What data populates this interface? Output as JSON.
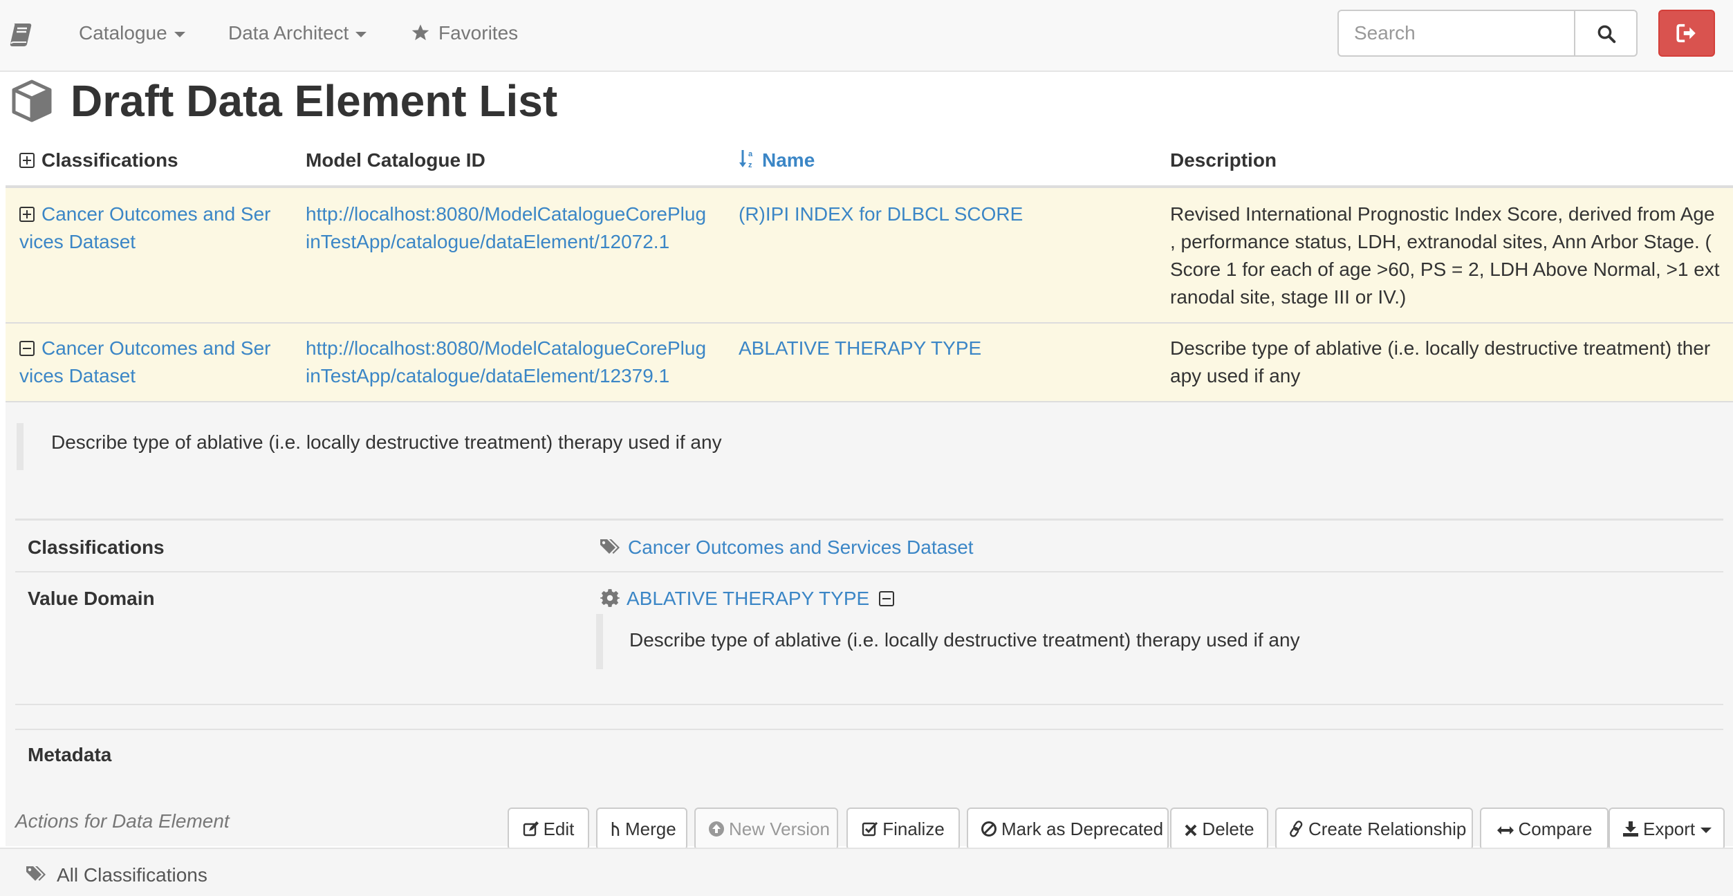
{
  "navbar": {
    "brand_icon": "book-icon",
    "items": [
      {
        "label": "Catalogue",
        "has_caret": true
      },
      {
        "label": "Data Architect",
        "has_caret": true
      },
      {
        "label": "Favorites",
        "icon": "star-icon"
      }
    ],
    "search": {
      "placeholder": "Search",
      "value": ""
    },
    "logout_icon": "sign-out-icon",
    "logout_color": "#d9534f"
  },
  "page": {
    "title": "Draft Data Element List",
    "icon": "cube-icon"
  },
  "table": {
    "headers": {
      "classifications": "Classifications",
      "id": "Model Catalogue ID",
      "name": "Name",
      "description": "Description"
    },
    "rows": [
      {
        "classification_l1": "Cancer Outcomes and Ser",
        "classification_l2": "vices Dataset",
        "id_l1": "http://localhost:8080/ModelCatalogueCorePlug",
        "id_l2": "inTestApp/catalogue/dataElement/12072.1",
        "name": "(R)IPI INDEX for DLBCL SCORE",
        "desc_l1": "Revised International Prognostic Index Score, derived from Age",
        "desc_l2": ", performance status, LDH, extranodal sites, Ann Arbor Stage. (",
        "desc_l3": "Score 1 for each of age >60, PS = 2, LDH Above Normal, >1 ext",
        "desc_l4": "ranodal site, stage III or IV.)"
      },
      {
        "classification_l1": "Cancer Outcomes and Ser",
        "classification_l2": "vices Dataset",
        "id_l1": "http://localhost:8080/ModelCatalogueCorePlug",
        "id_l2": "inTestApp/catalogue/dataElement/12379.1",
        "name": "ABLATIVE THERAPY TYPE",
        "desc_l1": "Describe type of ablative (i.e. locally destructive treatment) ther",
        "desc_l2": "apy used if any"
      }
    ]
  },
  "detail": {
    "description": "Describe type of ablative (i.e. locally destructive treatment) therapy used if any",
    "classifications_label": "Classifications",
    "classifications_value": "Cancer Outcomes and Services Dataset",
    "value_domain_label": "Value Domain",
    "value_domain_name": "ABLATIVE THERAPY TYPE",
    "value_domain_description": "Describe type of ablative (i.e. locally destructive treatment) therapy used if any",
    "metadata_label": "Metadata",
    "actions_label": "Actions for Data Element",
    "buttons": {
      "edit": "Edit",
      "merge": "Merge",
      "new_version": "New Version",
      "finalize": "Finalize",
      "deprecate": "Mark as Deprecated",
      "delete": "Delete",
      "relationship": "Create Relationship",
      "compare": "Compare",
      "export": "Export"
    }
  },
  "footer": {
    "label": "All Classifications",
    "icon": "tags-icon"
  }
}
